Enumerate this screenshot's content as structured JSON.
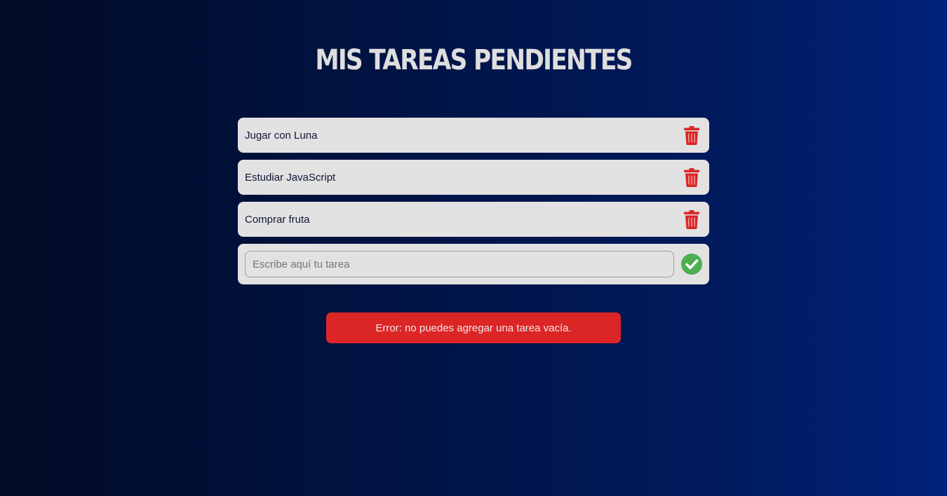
{
  "page": {
    "title": "MIS TAREAS PENDIENTES"
  },
  "tasks": [
    {
      "text": "Jugar con Luna",
      "icon": "trash-icon"
    },
    {
      "text": "Estudiar JavaScript",
      "icon": "trash-icon"
    },
    {
      "text": "Comprar fruta",
      "icon": "trash-icon"
    }
  ],
  "new_task": {
    "value": "",
    "placeholder": "Escribe aquí tu tarea",
    "submit_icon": "check-circle-icon"
  },
  "error": {
    "message": "Error: no puedes agregar una tarea vacía."
  },
  "colors": {
    "background_start": "#020b26",
    "background_end": "#00227a",
    "card": "#e2e2e2",
    "delete": "#dc2626",
    "confirm": "#4caf50",
    "error_bg": "#dc2626"
  }
}
